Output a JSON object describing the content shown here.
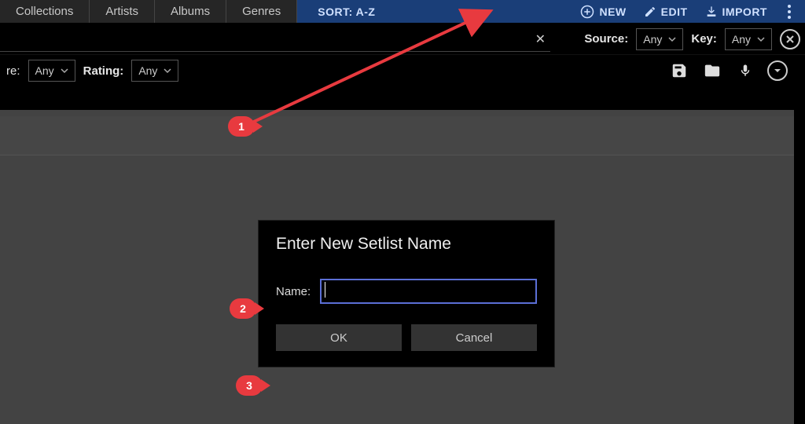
{
  "nav": {
    "tabs": [
      "Collections",
      "Artists",
      "Albums",
      "Genres"
    ]
  },
  "actionbar": {
    "sort": "SORT: A-Z",
    "new": "NEW",
    "edit": "EDIT",
    "import": "IMPORT"
  },
  "filters": {
    "source_label": "Source:",
    "source_value": "Any",
    "key_label": "Key:",
    "key_value": "Any",
    "left_suffix": "re:",
    "left_value": "Any",
    "rating_label": "Rating:",
    "rating_value": "Any",
    "search_value": ""
  },
  "dialog": {
    "title": "Enter New Setlist Name",
    "name_label": "Name:",
    "name_value": "",
    "ok": "OK",
    "cancel": "Cancel"
  },
  "annotations": {
    "m1": "1",
    "m2": "2",
    "m3": "3"
  }
}
